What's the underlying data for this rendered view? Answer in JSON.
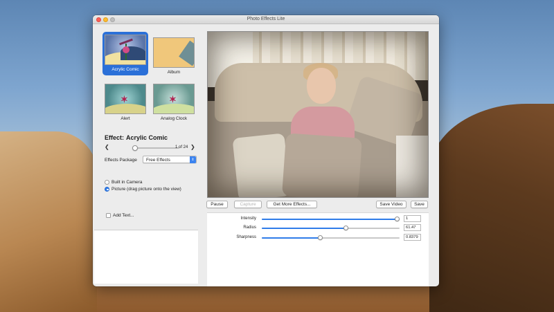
{
  "window": {
    "title": "Photo Effects Lite"
  },
  "thumbnails": [
    {
      "label": "Acrylic Comic",
      "selected": true
    },
    {
      "label": "Album",
      "selected": false
    },
    {
      "label": "Alert",
      "selected": false
    },
    {
      "label": "Analog Clock",
      "selected": false
    }
  ],
  "effect": {
    "prefix": "Effect:",
    "name": "Acrylic Comic"
  },
  "navigator": {
    "count": "1 of 24",
    "position_fraction": 0.0
  },
  "package": {
    "label": "Effects Package",
    "value": "Free Effects"
  },
  "source": {
    "options": [
      {
        "label": "Built in Camera",
        "selected": false
      },
      {
        "label": "Picture (drag picture onto the view)",
        "selected": true
      }
    ]
  },
  "add_text": {
    "label": "Add Text...",
    "checked": false
  },
  "buttons": {
    "pause": "Pause",
    "capture": "Capture",
    "more": "Get More Effects...",
    "save_video": "Save Video",
    "save": "Save"
  },
  "params": [
    {
      "label": "Intensity",
      "value": "1",
      "fraction": 1.0
    },
    {
      "label": "Radius",
      "value": "61.47",
      "fraction": 0.61
    },
    {
      "label": "Sharpness",
      "value": "0.8379",
      "fraction": 0.42
    }
  ],
  "colors": {
    "accent": "#2f7ce9",
    "selection": "#2b70d8"
  }
}
